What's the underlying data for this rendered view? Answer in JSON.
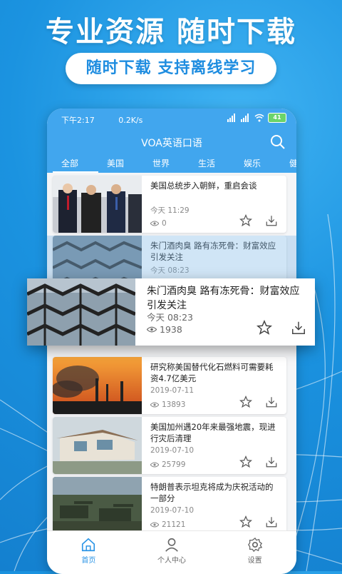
{
  "promo": {
    "headline": "专业资源  随时下载",
    "tagline": "随时下载 支持离线学习"
  },
  "status_bar": {
    "time": "下午2:17",
    "speed": "0.2K/s",
    "battery": "41"
  },
  "app": {
    "title": "VOA英语口语"
  },
  "tabs": [
    {
      "label": "全部",
      "active": true
    },
    {
      "label": "美国"
    },
    {
      "label": "世界"
    },
    {
      "label": "生活"
    },
    {
      "label": "娱乐"
    },
    {
      "label": "健"
    }
  ],
  "articles": [
    {
      "title": "美国总统步入朝鲜，重启会谈",
      "date": "今天 11:29",
      "views": "0",
      "thumb": "politicians"
    },
    {
      "title": "朱门酒肉臭 路有冻死骨：财富效应引发关注",
      "date": "今天 08:23",
      "views": "1938",
      "thumb": "vessel-structure"
    },
    {
      "title": "研究称美国替代化石燃料可需要耗资4.7亿美元",
      "date": "2019-07-11",
      "views": "13893",
      "thumb": "factory-sunset"
    },
    {
      "title": "美国加州遇20年来最强地震，现进行灾后清理",
      "date": "2019-07-10",
      "views": "25799",
      "thumb": "earthquake-house"
    },
    {
      "title": "特朗普表示坦克将成为庆祝活动的一部分",
      "date": "2019-07-10",
      "views": "21121",
      "thumb": "tanks"
    }
  ],
  "popup": {
    "title": "朱门酒肉臭 路有冻死骨：财富效应引发关注",
    "date": "今天  08:23",
    "views": "1938"
  },
  "bottom_nav": [
    {
      "label": "首页",
      "icon": "home-icon",
      "active": true
    },
    {
      "label": "个人中心",
      "icon": "user-icon"
    },
    {
      "label": "设置",
      "icon": "gear-icon"
    }
  ],
  "colors": {
    "brand_blue": "#41a6ee",
    "background_blue": "#1b93e0",
    "accent_text": "#1f8de0"
  }
}
